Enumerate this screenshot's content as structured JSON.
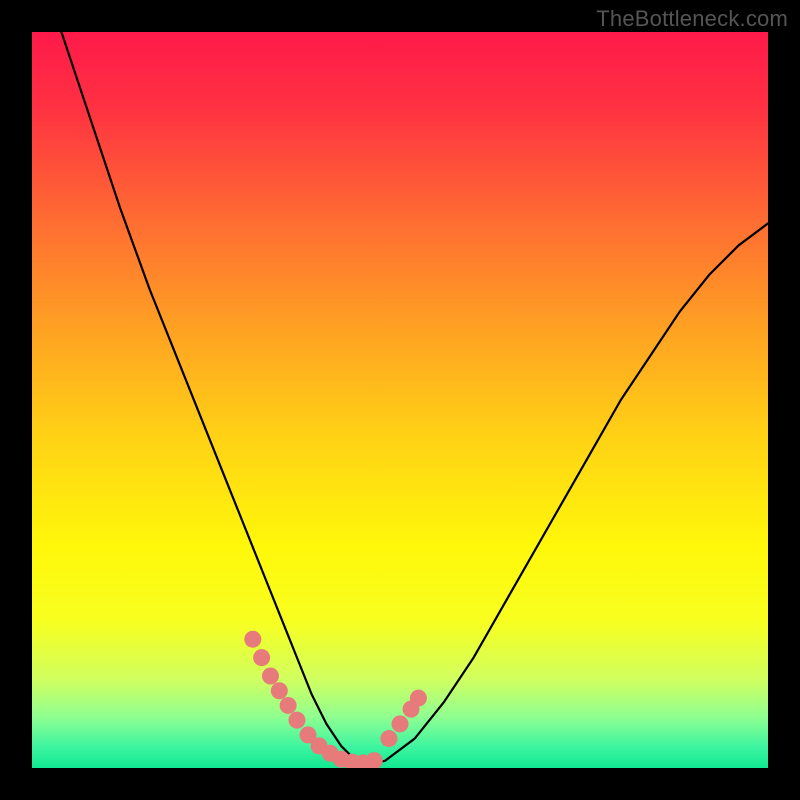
{
  "watermark": "TheBottleneck.com",
  "chart_data": {
    "type": "line",
    "title": "",
    "xlabel": "",
    "ylabel": "",
    "xlim": [
      0,
      100
    ],
    "ylim": [
      0,
      100
    ],
    "grid": false,
    "legend": false,
    "series": [
      {
        "name": "bottleneck-curve",
        "color": "#000000",
        "x": [
          4,
          8,
          12,
          16,
          20,
          24,
          28,
          30,
          32,
          34,
          36,
          38,
          40,
          42,
          44,
          46,
          48,
          52,
          56,
          60,
          64,
          68,
          72,
          76,
          80,
          84,
          88,
          92,
          96,
          100
        ],
        "y": [
          100,
          88,
          76,
          65,
          55,
          45,
          35,
          30,
          25,
          20,
          15,
          10,
          6,
          3,
          1,
          0.5,
          1,
          4,
          9,
          15,
          22,
          29,
          36,
          43,
          50,
          56,
          62,
          67,
          71,
          74
        ]
      }
    ],
    "markers": [
      {
        "name": "left-branch-markers",
        "color": "#e77a7a",
        "x": [
          30.0,
          31.2,
          32.4,
          33.6,
          34.8,
          36.0
        ],
        "y": [
          17.5,
          15.0,
          12.5,
          10.5,
          8.5,
          6.5
        ]
      },
      {
        "name": "trough-markers",
        "color": "#e77a7a",
        "x": [
          37.5,
          39.0,
          40.5,
          42.0,
          43.5,
          45.0,
          46.5
        ],
        "y": [
          4.5,
          3.0,
          2.0,
          1.2,
          0.8,
          0.7,
          1.0
        ]
      },
      {
        "name": "right-branch-markers",
        "color": "#e77a7a",
        "x": [
          48.5,
          50.0,
          51.5,
          52.5
        ],
        "y": [
          4.0,
          6.0,
          8.0,
          9.5
        ]
      }
    ],
    "background_gradient": {
      "stops": [
        {
          "offset": 0.0,
          "color": "#ff1a4a"
        },
        {
          "offset": 0.1,
          "color": "#ff3042"
        },
        {
          "offset": 0.25,
          "color": "#ff6a33"
        },
        {
          "offset": 0.4,
          "color": "#ffa023"
        },
        {
          "offset": 0.55,
          "color": "#ffd215"
        },
        {
          "offset": 0.7,
          "color": "#fff80a"
        },
        {
          "offset": 0.8,
          "color": "#f8ff20"
        },
        {
          "offset": 0.88,
          "color": "#d0ff60"
        },
        {
          "offset": 0.93,
          "color": "#90ff90"
        },
        {
          "offset": 0.97,
          "color": "#40f5a0"
        },
        {
          "offset": 1.0,
          "color": "#10e890"
        }
      ]
    }
  }
}
